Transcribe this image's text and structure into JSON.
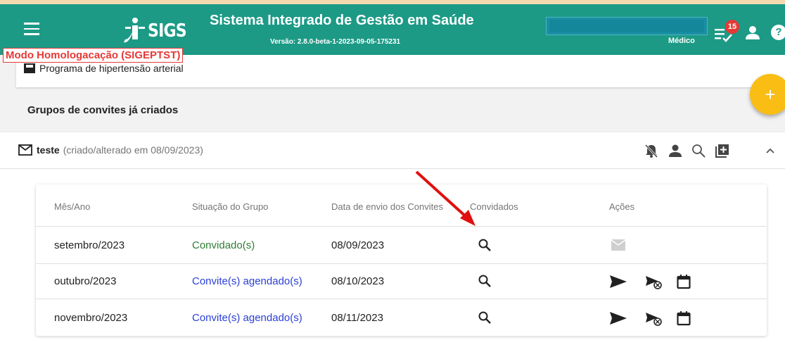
{
  "header": {
    "logo_text": "SIGS",
    "title": "Sistema Integrado de Gestão em Saúde",
    "version": "Versão: 2.8.0-beta-1-2023-09-05-175231",
    "role": "Médico",
    "notification_count": "15",
    "help_symbol": "?"
  },
  "homolog_banner": "Modo Homologacação (SIGEPTST)",
  "program": {
    "label": "Programa de hipertensão arterial"
  },
  "fab_symbol": "+",
  "section_title": "Grupos de convites já criados",
  "group": {
    "name": "teste",
    "meta": "(criado/alterado em 08/09/2023)"
  },
  "table": {
    "columns": [
      "Mês/Ano",
      "Situação do Grupo",
      "Data de envio dos Convites",
      "Convidados",
      "Ações"
    ],
    "rows": [
      {
        "month": "setembro/2023",
        "status": "Convidado(s)",
        "status_color": "#2e7d32",
        "date": "08/09/2023"
      },
      {
        "month": "outubro/2023",
        "status": "Convite(s) agendado(s)",
        "status_color": "#2a3fd6",
        "date": "08/10/2023"
      },
      {
        "month": "novembro/2023",
        "status": "Convite(s) agendado(s)",
        "status_color": "#2a3fd6",
        "date": "08/11/2023"
      }
    ]
  },
  "colors": {
    "appbar": "#1c9a86",
    "fab": "#f9bd14",
    "badge": "#e53935",
    "arrow": "#e01010"
  }
}
